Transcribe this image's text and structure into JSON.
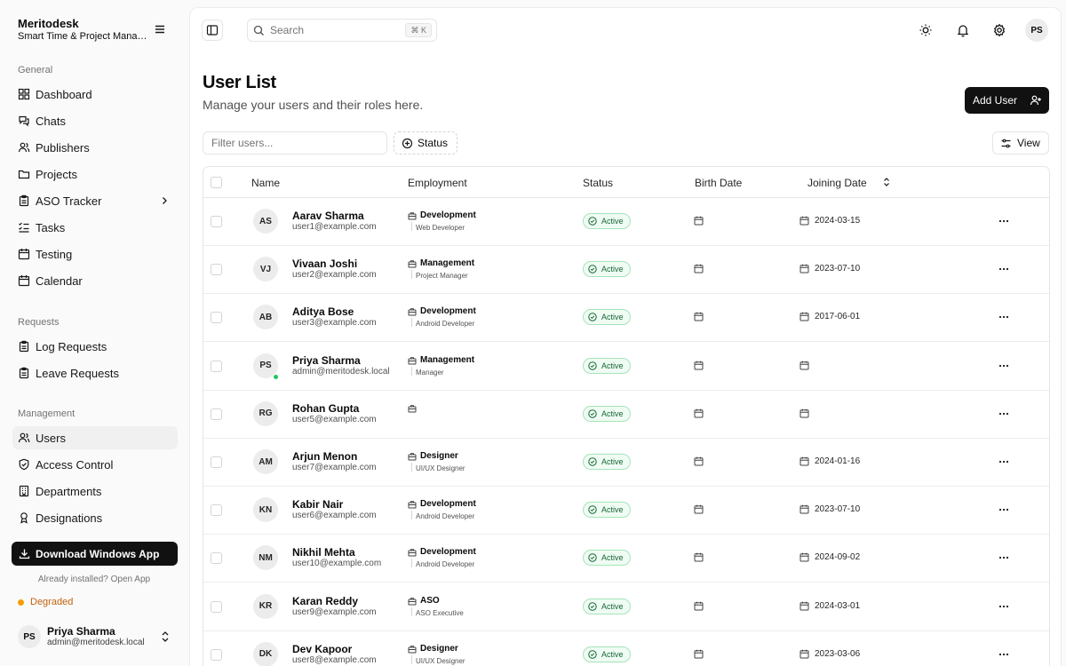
{
  "brand": {
    "name": "Meritodesk",
    "subtitle": "Smart Time & Project Management"
  },
  "sidebar": {
    "general_label": "General",
    "general": [
      {
        "label": "Dashboard",
        "icon": "dashboard-icon"
      },
      {
        "label": "Chats",
        "icon": "chat-icon"
      },
      {
        "label": "Publishers",
        "icon": "users-icon"
      },
      {
        "label": "Projects",
        "icon": "folder-icon"
      },
      {
        "label": "ASO Tracker",
        "icon": "clipboard-icon"
      },
      {
        "label": "Tasks",
        "icon": "list-check-icon"
      },
      {
        "label": "Testing",
        "icon": "calendar-icon"
      },
      {
        "label": "Calendar",
        "icon": "calendar-icon"
      }
    ],
    "requests_label": "Requests",
    "requests": [
      {
        "label": "Log Requests",
        "icon": "clipboard-icon"
      },
      {
        "label": "Leave Requests",
        "icon": "clipboard-icon"
      }
    ],
    "management_label": "Management",
    "management": [
      {
        "label": "Users",
        "icon": "users-icon"
      },
      {
        "label": "Access Control",
        "icon": "shield-icon"
      },
      {
        "label": "Departments",
        "icon": "building-icon"
      },
      {
        "label": "Designations",
        "icon": "badge-icon"
      }
    ],
    "download_label": "Download Windows App",
    "installed_text": "Already installed? Open App",
    "status_text": "Degraded",
    "user": {
      "initials": "PS",
      "name": "Priya Sharma",
      "email": "admin@meritodesk.local"
    }
  },
  "topbar": {
    "search_placeholder": "Search",
    "shortcut": "⌘ K",
    "avatar": "PS"
  },
  "page": {
    "title": "User List",
    "subtitle": "Manage your users and their roles here.",
    "add_user_label": "Add User",
    "filter_placeholder": "Filter users...",
    "status_filter_label": "Status",
    "view_label": "View"
  },
  "table": {
    "headers": {
      "name": "Name",
      "employment": "Employment",
      "status": "Status",
      "birth_date": "Birth Date",
      "joining_date": "Joining Date"
    },
    "rows": [
      {
        "initials": "AS",
        "name": "Aarav Sharma",
        "email": "user1@example.com",
        "department": "Development",
        "role": "Web Developer",
        "status": "Active",
        "birth_date": "",
        "joining_date": "2024-03-15",
        "online": false
      },
      {
        "initials": "VJ",
        "name": "Vivaan Joshi",
        "email": "user2@example.com",
        "department": "Management",
        "role": "Project Manager",
        "status": "Active",
        "birth_date": "",
        "joining_date": "2023-07-10",
        "online": false
      },
      {
        "initials": "AB",
        "name": "Aditya Bose",
        "email": "user3@example.com",
        "department": "Development",
        "role": "Android Developer",
        "status": "Active",
        "birth_date": "",
        "joining_date": "2017-06-01",
        "online": false
      },
      {
        "initials": "PS",
        "name": "Priya Sharma",
        "email": "admin@meritodesk.local",
        "department": "Management",
        "role": "Manager",
        "status": "Active",
        "birth_date": "",
        "joining_date": "",
        "online": true
      },
      {
        "initials": "RG",
        "name": "Rohan Gupta",
        "email": "user5@example.com",
        "department": "",
        "role": "",
        "status": "Active",
        "birth_date": "",
        "joining_date": "",
        "online": false
      },
      {
        "initials": "AM",
        "name": "Arjun Menon",
        "email": "user7@example.com",
        "department": "Designer",
        "role": "UI/UX Designer",
        "status": "Active",
        "birth_date": "",
        "joining_date": "2024-01-16",
        "online": false
      },
      {
        "initials": "KN",
        "name": "Kabir Nair",
        "email": "user6@example.com",
        "department": "Development",
        "role": "Android Developer",
        "status": "Active",
        "birth_date": "",
        "joining_date": "2023-07-10",
        "online": false
      },
      {
        "initials": "NM",
        "name": "Nikhil Mehta",
        "email": "user10@example.com",
        "department": "Development",
        "role": "Android Developer",
        "status": "Active",
        "birth_date": "",
        "joining_date": "2024-09-02",
        "online": false
      },
      {
        "initials": "KR",
        "name": "Karan Reddy",
        "email": "user9@example.com",
        "department": "ASO",
        "role": "ASO Executive",
        "status": "Active",
        "birth_date": "",
        "joining_date": "2024-03-01",
        "online": false
      },
      {
        "initials": "DK",
        "name": "Dev Kapoor",
        "email": "user8@example.com",
        "department": "Designer",
        "role": "UI/UX Designer",
        "status": "Active",
        "birth_date": "",
        "joining_date": "2023-03-06",
        "online": false
      }
    ]
  }
}
